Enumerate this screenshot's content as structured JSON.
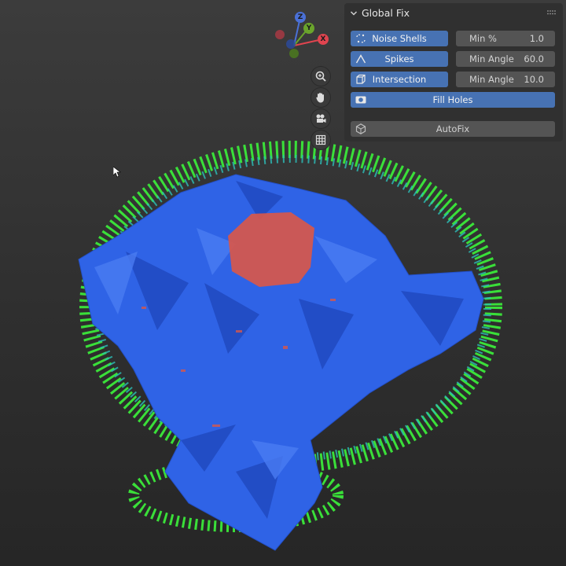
{
  "panel": {
    "title": "Global Fix",
    "rows": [
      {
        "button": "Noise Shells",
        "icon": "noise-shells-icon",
        "field_label": "Min %",
        "field_value": "1.0"
      },
      {
        "button": "Spikes",
        "icon": "spikes-icon",
        "field_label": "Min Angle",
        "field_value": "60.0"
      },
      {
        "button": "Intersection",
        "icon": "intersection-icon",
        "field_label": "Min Angle",
        "field_value": "10.0"
      }
    ],
    "fill_holes": "Fill Holes",
    "autofix": "AutoFix"
  },
  "gizmo": {
    "x": "X",
    "y": "Y",
    "z": "Z"
  },
  "colors": {
    "button_blue": "#4772b3",
    "mesh_blue": "#2e62e8",
    "mesh_red": "#d9574a",
    "noise_green": "#3ee83a",
    "axis_x": "#e0444f",
    "axis_y": "#6aa42c",
    "axis_z": "#4a70d6"
  }
}
